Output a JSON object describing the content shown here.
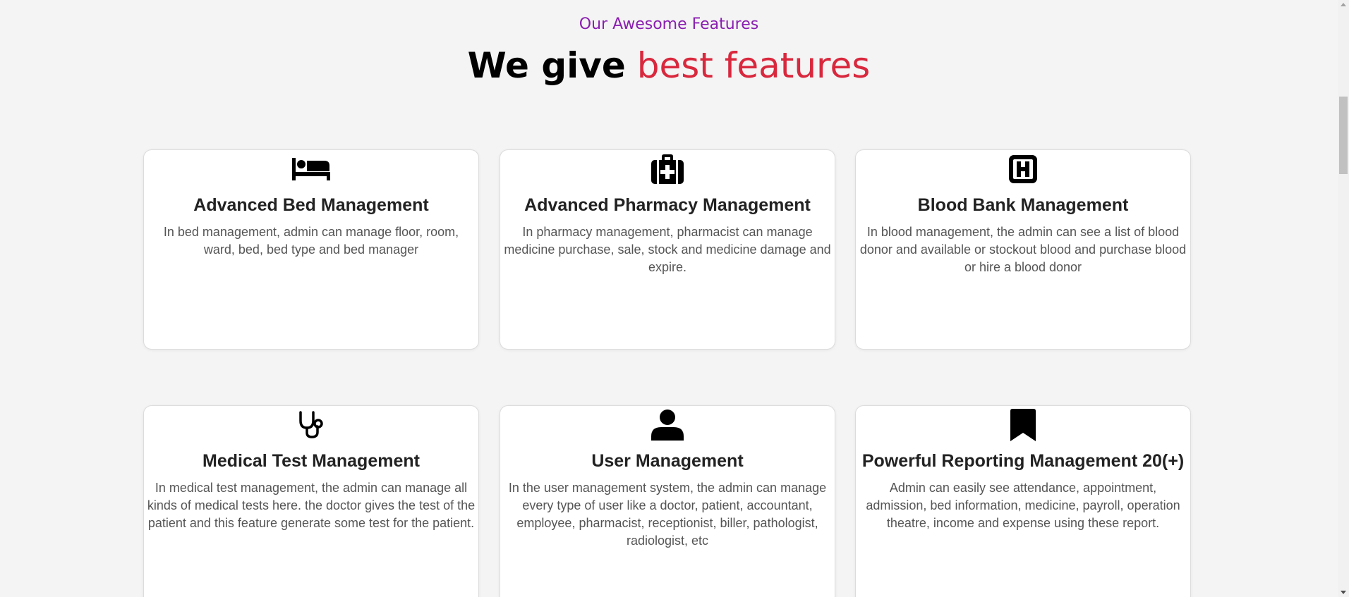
{
  "header": {
    "subtitle": "Our Awesome Features",
    "title_part1": "We give",
    "title_part2": "best features",
    "colors": {
      "subtitle": "#8a1eb0",
      "accent": "#d9283d"
    }
  },
  "features": [
    {
      "icon": "bed-icon",
      "title": "Advanced Bed Management",
      "description": "In bed management, admin can manage floor, room, ward, bed, bed type and bed manager"
    },
    {
      "icon": "first-aid-kit-icon",
      "title": "Advanced Pharmacy Management",
      "description": "In pharmacy management, pharmacist can manage medicine purchase, sale, stock and medicine damage and expire."
    },
    {
      "icon": "hospital-h-icon",
      "title": "Blood Bank Management",
      "description": "In blood management, the admin can see a list of blood donor and available or stockout blood and purchase blood or hire a blood donor"
    },
    {
      "icon": "stethoscope-icon",
      "title": "Medical Test Management",
      "description": "In medical test management, the admin can manage all kinds of medical tests here. the doctor gives the test of the patient and this feature generate some test for the patient."
    },
    {
      "icon": "user-icon",
      "title": "User Management",
      "description": "In the user management system, the admin can manage every type of user like a doctor, patient, accountant, employee, pharmacist, receptionist, biller, pathologist, radiologist, etc"
    },
    {
      "icon": "bookmark-icon",
      "title": "Powerful Reporting Management 20(+)",
      "description": "Admin can easily see attendance, appointment, admission, bed information, medicine, payroll, operation theatre, income and expense using these report."
    }
  ]
}
